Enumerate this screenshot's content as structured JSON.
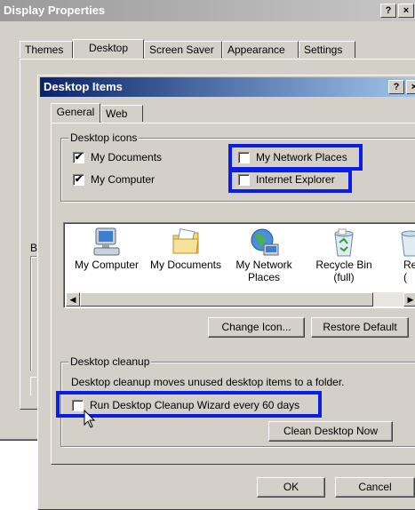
{
  "outer": {
    "title": "Display Properties",
    "help_btn": "?",
    "close_btn": "×",
    "tabs": [
      "Themes",
      "Desktop",
      "Screen Saver",
      "Appearance",
      "Settings"
    ],
    "partial_label": "B"
  },
  "inner": {
    "title": "Desktop Items",
    "help_btn": "?",
    "close_btn": "×",
    "tabs": [
      "General",
      "Web"
    ],
    "desktop_icons": {
      "legend": "Desktop icons",
      "items": [
        {
          "label": "My Documents",
          "checked": "✔"
        },
        {
          "label": "My Computer",
          "checked": "✔"
        },
        {
          "label": "My Network Places",
          "checked": ""
        },
        {
          "label": "Internet Explorer",
          "checked": ""
        }
      ]
    },
    "icons": [
      {
        "label": "My Computer",
        "icon": "computer-icon"
      },
      {
        "label": "My Documents",
        "icon": "folder-icon"
      },
      {
        "label": "My Network\nPlaces",
        "icon": "network-places-icon"
      },
      {
        "label": "Recycle Bin\n(full)",
        "icon": "recycle-bin-icon"
      },
      {
        "label": "Re\n(",
        "icon": "recycle-bin-empty-icon"
      }
    ],
    "buttons": {
      "change_icon": "Change Icon...",
      "restore_default": "Restore Default",
      "ok": "OK",
      "cancel": "Cancel",
      "clean_now": "Clean Desktop Now"
    },
    "cleanup": {
      "legend": "Desktop cleanup",
      "description": "Desktop cleanup moves unused desktop items to a folder.",
      "checkbox_label": "Run Desktop Cleanup Wizard every 60 days"
    }
  },
  "colors": {
    "highlight_box": "#0a1ee6",
    "inner_title": "#0a246a",
    "dialog_face": "#d4d0c8"
  }
}
